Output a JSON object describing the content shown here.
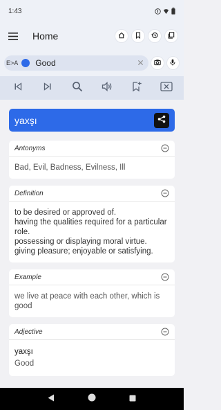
{
  "status": {
    "time": "1:43",
    "icons": [
      "warning-icon",
      "wifi-icon",
      "battery-icon"
    ]
  },
  "appbar": {
    "title": "Home",
    "actions": [
      "home-icon",
      "bookmark-icon",
      "history-icon",
      "flashcards-icon"
    ]
  },
  "search": {
    "lang_label": "E>A",
    "query": "Good"
  },
  "toolbar": {
    "icons": [
      "skip-previous-icon",
      "skip-next-icon",
      "search-icon",
      "speaker-icon",
      "add-bookmark-icon",
      "clear-icon"
    ]
  },
  "result": {
    "word": "yaxşı",
    "sections": {
      "antonyms": {
        "label": "Antonyms",
        "text": "Bad, Evil, Badness, Evilness, Ill"
      },
      "definition": {
        "label": "Definition",
        "lines": [
          "to be desired or approved of.",
          "having the qualities required for a particular role.",
          "possessing or displaying moral virtue.",
          "giving pleasure; enjoyable or satisfying."
        ]
      },
      "example": {
        "label": "Example",
        "text": "we live at peace with each other, which is good"
      },
      "adjective": {
        "label": "Adjective",
        "word": "yaxşı",
        "translation": "Good"
      }
    }
  },
  "colors": {
    "accent": "#2d6ae8",
    "appbar_bg": "#eef1f7",
    "toolbar_bg": "#dde3ef",
    "page_bg": "#f1f1f4"
  }
}
